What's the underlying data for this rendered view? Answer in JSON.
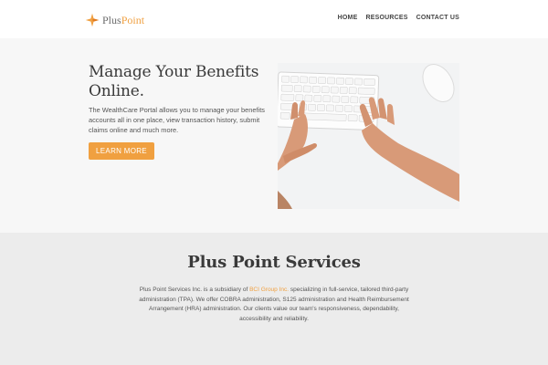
{
  "header": {
    "brand_part1": "Plus",
    "brand_part2": "Point",
    "nav": [
      "HOME",
      "RESOURCES",
      "CONTACT US"
    ]
  },
  "hero": {
    "title": "Manage Your Benefits Online.",
    "description": "The WealthCare Portal allows you to manage your benefits accounts all in one place, view transaction history, submit claims online and much more.",
    "button_label": "LEARN MORE"
  },
  "services": {
    "title": "Plus Point Services",
    "desc_before": "Plus Point Services Inc. is a subsidiary of ",
    "desc_link": "BCI Group Inc.",
    "desc_after": " specializing in full-service, tailored third-party administration (TPA).  We offer COBRA administration, S125 administration and Health Reimbursement Arrangement (HRA) administration. Our clients value our team's responsiveness, dependability, accessibility and reliability."
  },
  "colors": {
    "accent": "#f0a040",
    "hero_bg": "#f7f7f7",
    "services_bg": "#ececec"
  },
  "icons": [
    "pluspoint-logo-icon"
  ]
}
